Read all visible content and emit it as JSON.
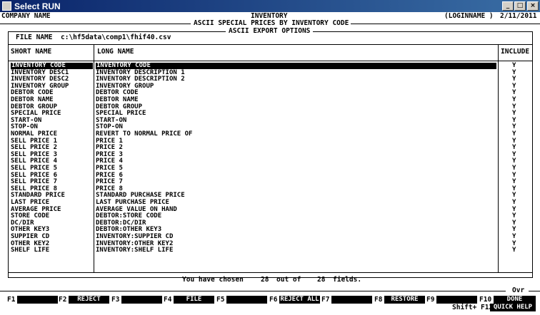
{
  "window": {
    "title": "Select RUN"
  },
  "header": {
    "company": "COMPANY NAME",
    "module": "INVENTORY",
    "login": "(LOGINNAME )",
    "date": "2/11/2011",
    "report_title": "ASCII SPECIAL PRICES BY INVENTORY CODE",
    "section_title": "ASCII EXPORT OPTIONS"
  },
  "file": {
    "label": "FILE NAME",
    "value": "c:\\hf5data\\comp1\\fhif40.csv"
  },
  "columns": {
    "short": "SHORT NAME",
    "long": "LONG NAME",
    "include": "INCLUDE"
  },
  "fields": [
    {
      "short": "INVENTORY CODE",
      "long": "INVENTORY CODE",
      "inc": "Y"
    },
    {
      "short": "INVENTORY DESC1",
      "long": "INVENTORY DESCRIPTION 1",
      "inc": "Y"
    },
    {
      "short": "INVENTORY DESC2",
      "long": "INVENTORY DESCRIPTION 2",
      "inc": "Y"
    },
    {
      "short": "INVENTORY GROUP",
      "long": "INVENTORY GROUP",
      "inc": "Y"
    },
    {
      "short": "DEBTOR CODE",
      "long": "DEBTOR CODE",
      "inc": "Y"
    },
    {
      "short": "DEBTOR NAME",
      "long": "DEBTOR NAME",
      "inc": "Y"
    },
    {
      "short": "DEBTOR GROUP",
      "long": "DEBTOR GROUP",
      "inc": "Y"
    },
    {
      "short": "SPECIAL PRICE",
      "long": "SPECIAL PRICE",
      "inc": "Y"
    },
    {
      "short": "START-ON",
      "long": "START-ON",
      "inc": "Y"
    },
    {
      "short": "STOP-ON",
      "long": "STOP-ON",
      "inc": "Y"
    },
    {
      "short": "NORMAL PRICE",
      "long": "REVERT TO NORMAL PRICE OF",
      "inc": "Y"
    },
    {
      "short": "SELL PRICE 1",
      "long": "PRICE 1",
      "inc": "Y"
    },
    {
      "short": "SELL PRICE 2",
      "long": "PRICE 2",
      "inc": "Y"
    },
    {
      "short": "SELL PRICE 3",
      "long": "PRICE 3",
      "inc": "Y"
    },
    {
      "short": "SELL PRICE 4",
      "long": "PRICE 4",
      "inc": "Y"
    },
    {
      "short": "SELL PRICE 5",
      "long": "PRICE 5",
      "inc": "Y"
    },
    {
      "short": "SELL PRICE 6",
      "long": "PRICE 6",
      "inc": "Y"
    },
    {
      "short": "SELL PRICE 7",
      "long": "PRICE 7",
      "inc": "Y"
    },
    {
      "short": "SELL PRICE 8",
      "long": "PRICE 8",
      "inc": "Y"
    },
    {
      "short": "STANDARD PRICE",
      "long": "STANDARD PURCHASE PRICE",
      "inc": "Y"
    },
    {
      "short": "LAST PRICE",
      "long": "LAST PURCHASE PRICE",
      "inc": "Y"
    },
    {
      "short": "AVERAGE PRICE",
      "long": "AVERAGE VALUE ON HAND",
      "inc": "Y"
    },
    {
      "short": "STORE CODE",
      "long": "DEBTOR:STORE CODE",
      "inc": "Y"
    },
    {
      "short": "DC/DIR",
      "long": "DEBTOR:DC/DIR",
      "inc": "Y"
    },
    {
      "short": "OTHER KEY3",
      "long": "DEBTOR:OTHER KEY3",
      "inc": "Y"
    },
    {
      "short": "SUPPIER CD",
      "long": "INVENTORY:SUPPIER CD",
      "inc": "Y"
    },
    {
      "short": "OTHER KEY2",
      "long": "INVENTORY:OTHER KEY2",
      "inc": "Y"
    },
    {
      "short": "SHELF LIFE",
      "long": "INVENTORY:SHELF LIFE",
      "inc": "Y"
    }
  ],
  "status": {
    "prefix": "You have chosen",
    "chosen": "28",
    "middle": "out of",
    "total": "28",
    "suffix": "fields."
  },
  "fkeys": [
    {
      "key": "F1",
      "label": ""
    },
    {
      "key": "F2",
      "label": "REJECT"
    },
    {
      "key": "F3",
      "label": ""
    },
    {
      "key": "F4",
      "label": "FILE"
    },
    {
      "key": "F5",
      "label": ""
    },
    {
      "key": "F6",
      "label": "REJECT ALL"
    },
    {
      "key": "F7",
      "label": ""
    },
    {
      "key": "F8",
      "label": "RESTORE"
    },
    {
      "key": "F9",
      "label": ""
    },
    {
      "key": "F10",
      "label": "DONE"
    }
  ],
  "footer": {
    "ovr": "Ovr",
    "shift_f12": "Shift+ F12",
    "quick_help": "QUICK HELP"
  }
}
